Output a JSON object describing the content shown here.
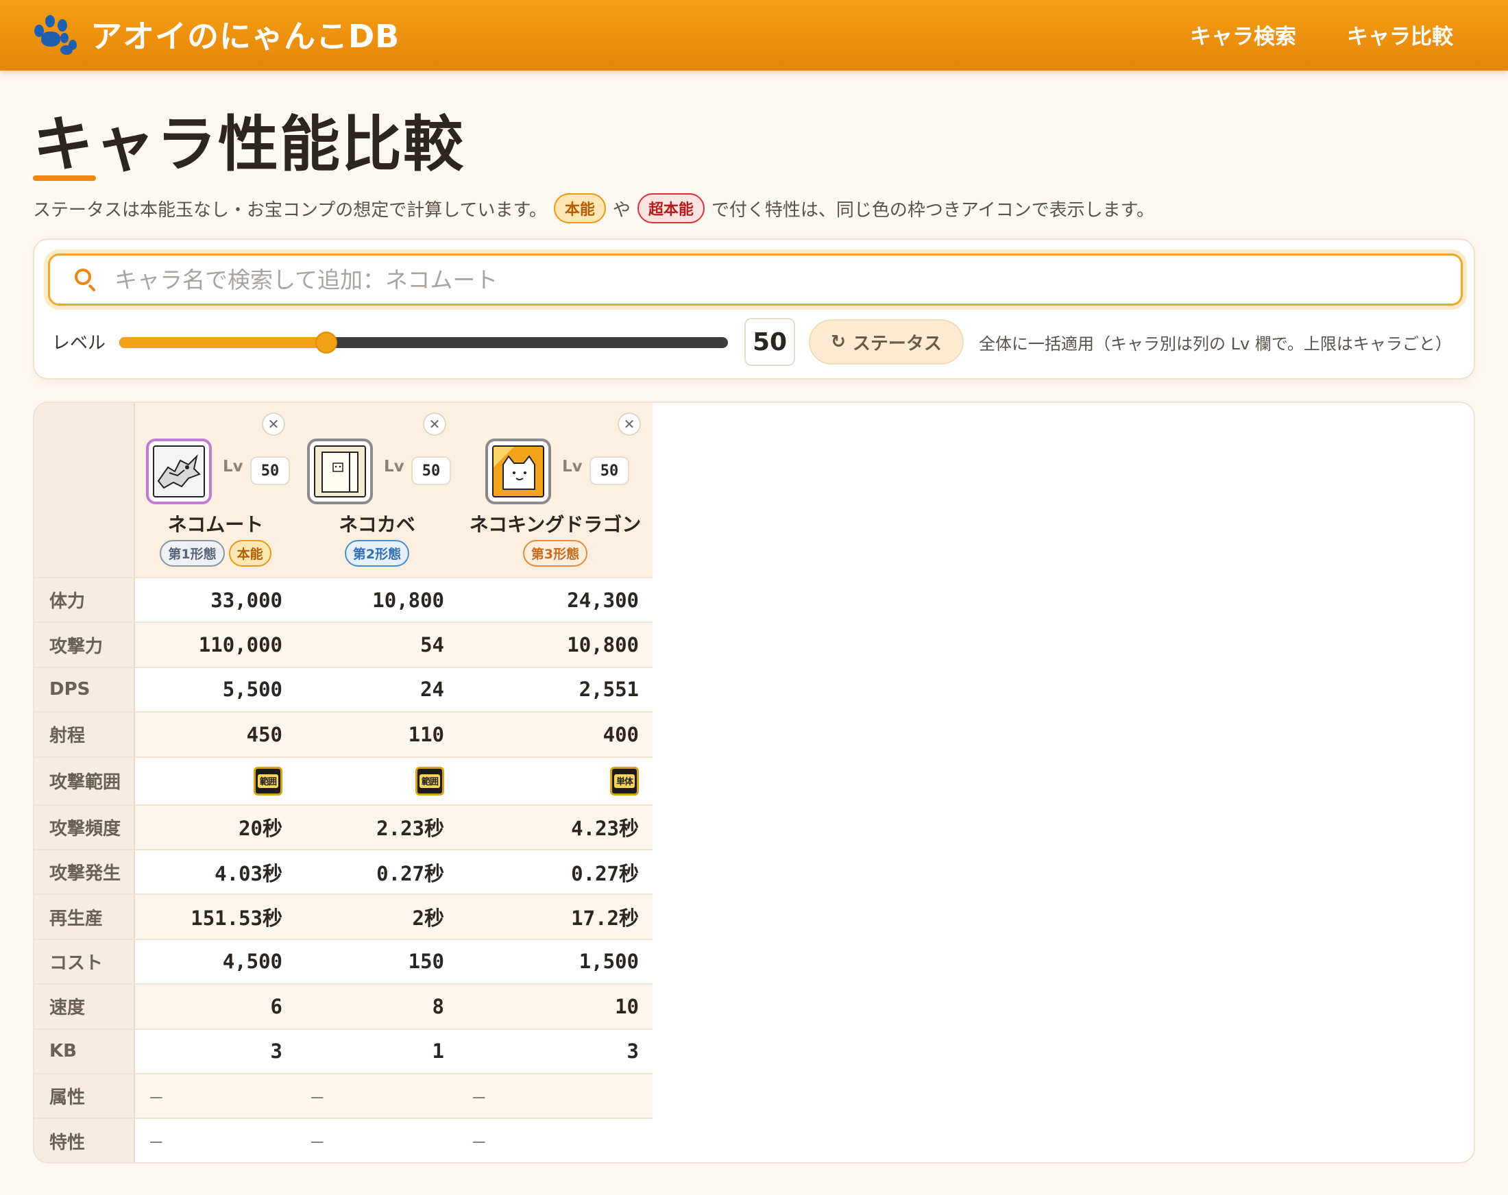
{
  "header": {
    "brand_title": "アオイのにゃんこDB",
    "nav": [
      "キャラ検索",
      "キャラ比較"
    ]
  },
  "page": {
    "title": "キャラ性能比較",
    "note_prefix": "ステータスは本能玉なし・お宝コンプの想定で計算しています。",
    "note_pill_honno": "本能",
    "note_mid": "や",
    "note_pill_cho": "超本能",
    "note_suffix": "で付く特性は、同じ色の枠つきアイコンで表示します。"
  },
  "controls": {
    "search_placeholder": "キャラ名で検索して追加：ネコムート",
    "level_label": "レベル",
    "level_value": "50",
    "level_fraction": 0.34,
    "status_button_label": "ステータス",
    "status_button_icon": "refresh-icon",
    "apply_note": "全体に一括適用（キャラ別は列の Lv 欄で。上限はキャラごと）"
  },
  "colors": {
    "accent": "#ee8612",
    "header": "#f5a014",
    "honno": "#e99a14",
    "cho_honno": "#d23434"
  },
  "table": {
    "lv_prefix": "Lv",
    "characters": [
      {
        "name": "ネコムート",
        "lv": "50",
        "badges": [
          "第1形態",
          "本能"
        ],
        "frame_color": "#c27ad6"
      },
      {
        "name": "ネコカベ",
        "lv": "50",
        "badges": [
          "第2形態"
        ],
        "frame_color": "#8a8a8a"
      },
      {
        "name": "ネコキングドラゴン",
        "lv": "50",
        "badges": [
          "第3形態"
        ],
        "frame_color": "#8a8a8a"
      }
    ],
    "rows": [
      {
        "label": "体力",
        "values": [
          "33,000",
          "10,800",
          "24,300"
        ]
      },
      {
        "label": "攻撃力",
        "values": [
          "110,000",
          "54",
          "10,800"
        ]
      },
      {
        "label": "DPS",
        "values": [
          "5,500",
          "24",
          "2,551"
        ]
      },
      {
        "label": "射程",
        "values": [
          "450",
          "110",
          "400"
        ]
      },
      {
        "label": "攻撃範囲",
        "values": [
          "範囲",
          "範囲",
          "単体"
        ]
      },
      {
        "label": "攻撃頻度",
        "values": [
          "20秒",
          "2.23秒",
          "4.23秒"
        ]
      },
      {
        "label": "攻撃発生",
        "values": [
          "4.03秒",
          "0.27秒",
          "0.27秒"
        ]
      },
      {
        "label": "再生産",
        "values": [
          "151.53秒",
          "2秒",
          "17.2秒"
        ]
      },
      {
        "label": "コスト",
        "values": [
          "4,500",
          "150",
          "1,500"
        ]
      },
      {
        "label": "速度",
        "values": [
          "6",
          "8",
          "10"
        ]
      },
      {
        "label": "KB",
        "values": [
          "3",
          "1",
          "3"
        ]
      },
      {
        "label": "属性",
        "values": [
          "—",
          "—",
          "—"
        ]
      },
      {
        "label": "特性",
        "values": [
          "—",
          "—",
          "—"
        ]
      }
    ]
  }
}
